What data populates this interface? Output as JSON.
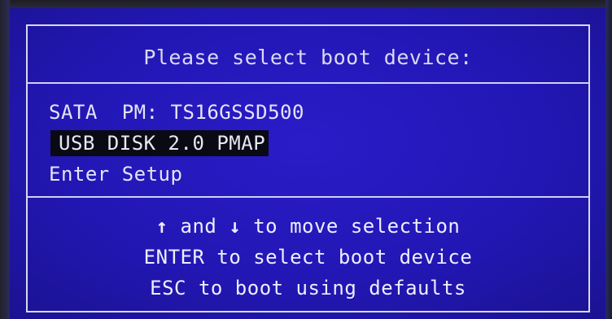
{
  "boot_menu": {
    "title": "Please select boot device:",
    "items": [
      {
        "label": "SATA  PM: TS16GSSD500",
        "selected": false
      },
      {
        "label": "USB DISK 2.0 PMAP",
        "selected": true
      },
      {
        "label": "Enter Setup",
        "selected": false
      }
    ],
    "help": {
      "line1_arrow_up": "↑",
      "line1_and": " and ",
      "line1_arrow_down": "↓",
      "line1_rest": " to move selection",
      "line2": "ENTER to select boot device",
      "line3": "ESC to boot using defaults"
    }
  },
  "colors": {
    "background": "#2217b4",
    "text": "#e4e4f6",
    "selection_background": "#0a0a14",
    "border": "#d8d8f0"
  }
}
